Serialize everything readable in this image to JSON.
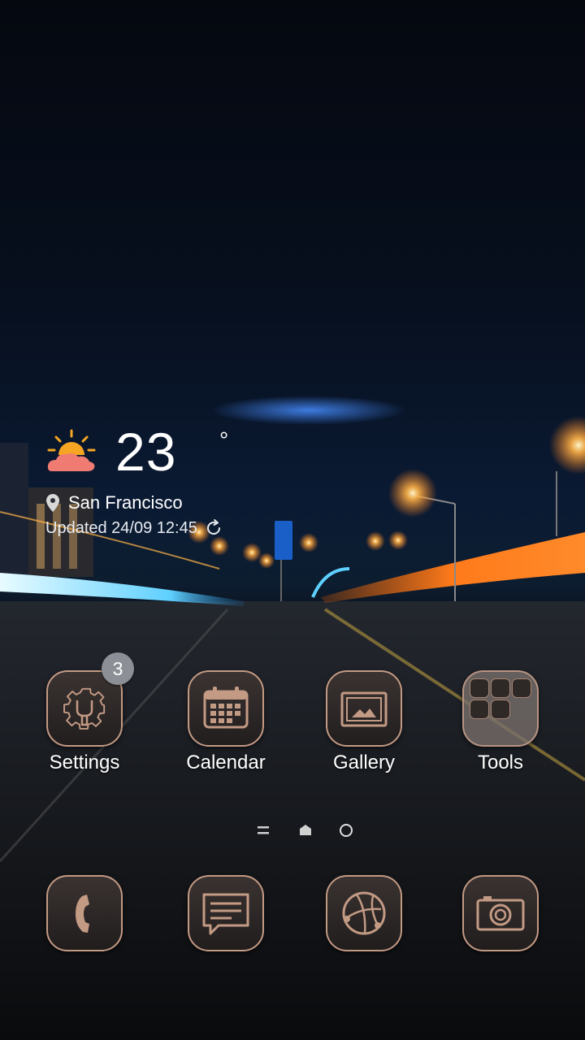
{
  "weather": {
    "temperature": "23",
    "degree_symbol": "°",
    "location": "San Francisco",
    "updated": "Updated 24/09 12:45",
    "icon": "partly-sunny-icon"
  },
  "apps": [
    {
      "label": "Settings",
      "icon": "gear-wrench-icon",
      "badge": "3"
    },
    {
      "label": "Calendar",
      "icon": "calendar-icon"
    },
    {
      "label": "Gallery",
      "icon": "image-icon"
    },
    {
      "label": "Tools",
      "icon": "folder-icon"
    }
  ],
  "pager": {
    "items": [
      "apps-list-icon",
      "home-icon",
      "page-dot"
    ]
  },
  "dock": [
    {
      "icon": "phone-icon"
    },
    {
      "icon": "messages-icon"
    },
    {
      "icon": "browser-icon"
    },
    {
      "icon": "camera-icon"
    }
  ],
  "colors": {
    "accent_border": "#c39a84",
    "badge": "#8c8f95",
    "light_orange": "#ff7a1a",
    "light_blue": "#5fd0ff"
  }
}
